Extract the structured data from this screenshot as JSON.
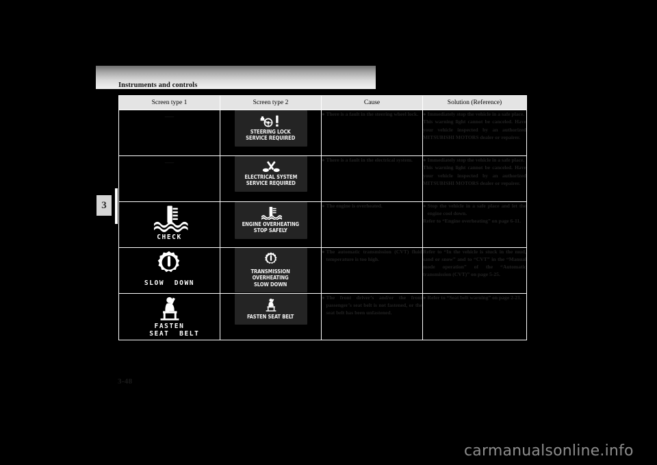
{
  "page": {
    "running_head": "Instruments and controls",
    "chapter_marker": "3",
    "folio": "3-48",
    "watermark": "carmanualsonline.info"
  },
  "table": {
    "headers": [
      "Screen type 1",
      "Screen type 2",
      "Cause",
      "Solution (Reference)"
    ],
    "rows": [
      {
        "screen1": {
          "kind": "dash",
          "dash": "—",
          "icon": "none-icon",
          "caption": ""
        },
        "screen2": {
          "kind": "panel",
          "icon": "steering-lock-icon",
          "caption": "STEERING LOCK\nSERVICE REQUIRED"
        },
        "cause": "There is a fault in the steering wheel lock.",
        "solution": "Immediately stop the vehicle in a safe place.",
        "solution_extra": "This warning light cannot be canceled. Have your vehicle inspected by an authorized MITSUBISHI MOTORS dealer or repairer."
      },
      {
        "screen1": {
          "kind": "dash",
          "dash": "—",
          "icon": "none-icon",
          "caption": ""
        },
        "screen2": {
          "kind": "panel",
          "icon": "electrical-system-icon",
          "caption": "ELECTRICAL SYSTEM\nSERVICE REQUIRED"
        },
        "cause": "There is a fault in the electrical system.",
        "solution": "Immediately stop the vehicle in a safe place.",
        "solution_extra": "This warning light cannot be canceled. Have your vehicle inspected by an authorized MITSUBISHI MOTORS dealer or repairer."
      },
      {
        "screen1": {
          "kind": "graphic",
          "icon": "coolant-temperature-icon",
          "caption": "CHECK"
        },
        "screen2": {
          "kind": "panel",
          "icon": "coolant-temperature-icon",
          "caption": "ENGINE OVERHEATING\nSTOP SAFELY"
        },
        "cause": "The engine is overheated.",
        "solution": "Stop the vehicle in a safe place and let the engine cool down.",
        "solution_extra": "Refer to “Engine overheating” on page 6-11."
      },
      {
        "screen1": {
          "kind": "graphic",
          "icon": "transmission-overheat-icon",
          "caption": "SLOW  DOWN"
        },
        "screen2": {
          "kind": "panel",
          "icon": "transmission-overheat-icon",
          "caption": "TRANSMISSION\nOVERHEATING\nSLOW DOWN"
        },
        "cause": "The automatic transmission (CVT) fluid temperature is too high.",
        "solution": "Refer to “In the vehicle is stuck in the mud, sand or snow” and to “CVT” in the “Manual mode operation” of the “Automatic transmission (CVT)” on page 5-25.",
        "solution_extra": ""
      },
      {
        "screen1": {
          "kind": "graphic",
          "icon": "seat-belt-icon",
          "caption": "FASTEN\n  SEAT  BELT"
        },
        "screen2": {
          "kind": "panel",
          "icon": "seat-belt-icon",
          "caption": "FASTEN SEAT BELT"
        },
        "cause": "The front driver’s and/or the front passenger’s seat belt is not fastened, or the seat belt has been unfastened.",
        "solution": "Refer to “Seat belt warning” on page 2-21.",
        "solution_extra": ""
      }
    ]
  }
}
